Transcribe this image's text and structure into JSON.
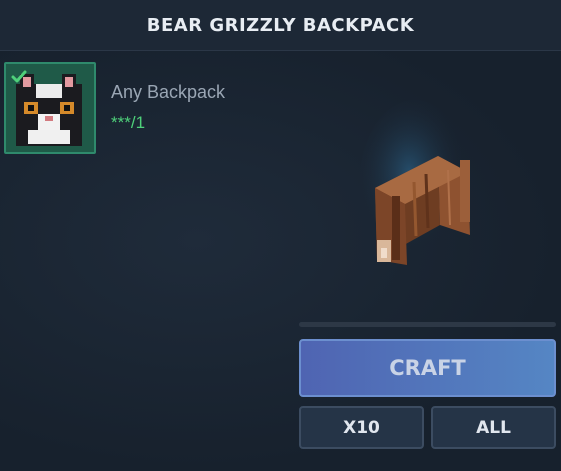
{
  "header": {
    "title": "BEAR GRIZZLY BACKPACK"
  },
  "ingredient": {
    "name": "Any Backpack",
    "count": "***/1",
    "icon": "tuxedo-cat-head-icon",
    "status_icon": "checkmark-icon",
    "accent_color": "#4ed07a"
  },
  "preview": {
    "icon": "grizzly-bear-backpack-icon"
  },
  "actions": {
    "craft_label": "CRAFT",
    "x10_label": "X10",
    "all_label": "ALL"
  }
}
